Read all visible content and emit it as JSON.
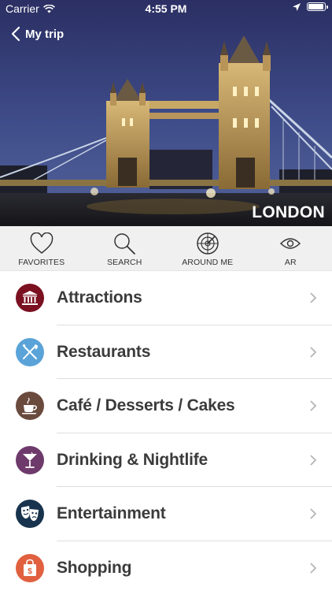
{
  "status": {
    "carrier": "Carrier",
    "time": "4:55 PM"
  },
  "nav": {
    "back_label": "My trip"
  },
  "hero": {
    "city": "LONDON"
  },
  "toolbar": {
    "items": [
      {
        "label": "FAVORITES",
        "icon": "heart-icon"
      },
      {
        "label": "SEARCH",
        "icon": "search-icon"
      },
      {
        "label": "AROUND ME",
        "icon": "radar-icon"
      },
      {
        "label": "AR",
        "icon": "eye-icon"
      }
    ]
  },
  "categories": [
    {
      "label": "Attractions",
      "icon": "museum-icon",
      "color": "#7a1020"
    },
    {
      "label": "Restaurants",
      "icon": "cutlery-icon",
      "color": "#5aa3d8"
    },
    {
      "label": "Café / Desserts / Cakes",
      "icon": "coffee-cup-icon",
      "color": "#6b4a3e"
    },
    {
      "label": "Drinking & Nightlife",
      "icon": "cocktail-icon",
      "color": "#6e3a6b"
    },
    {
      "label": "Entertainment",
      "icon": "theater-masks-icon",
      "color": "#17334d"
    },
    {
      "label": "Shopping",
      "icon": "shopping-bag-icon",
      "color": "#e0603f"
    }
  ]
}
